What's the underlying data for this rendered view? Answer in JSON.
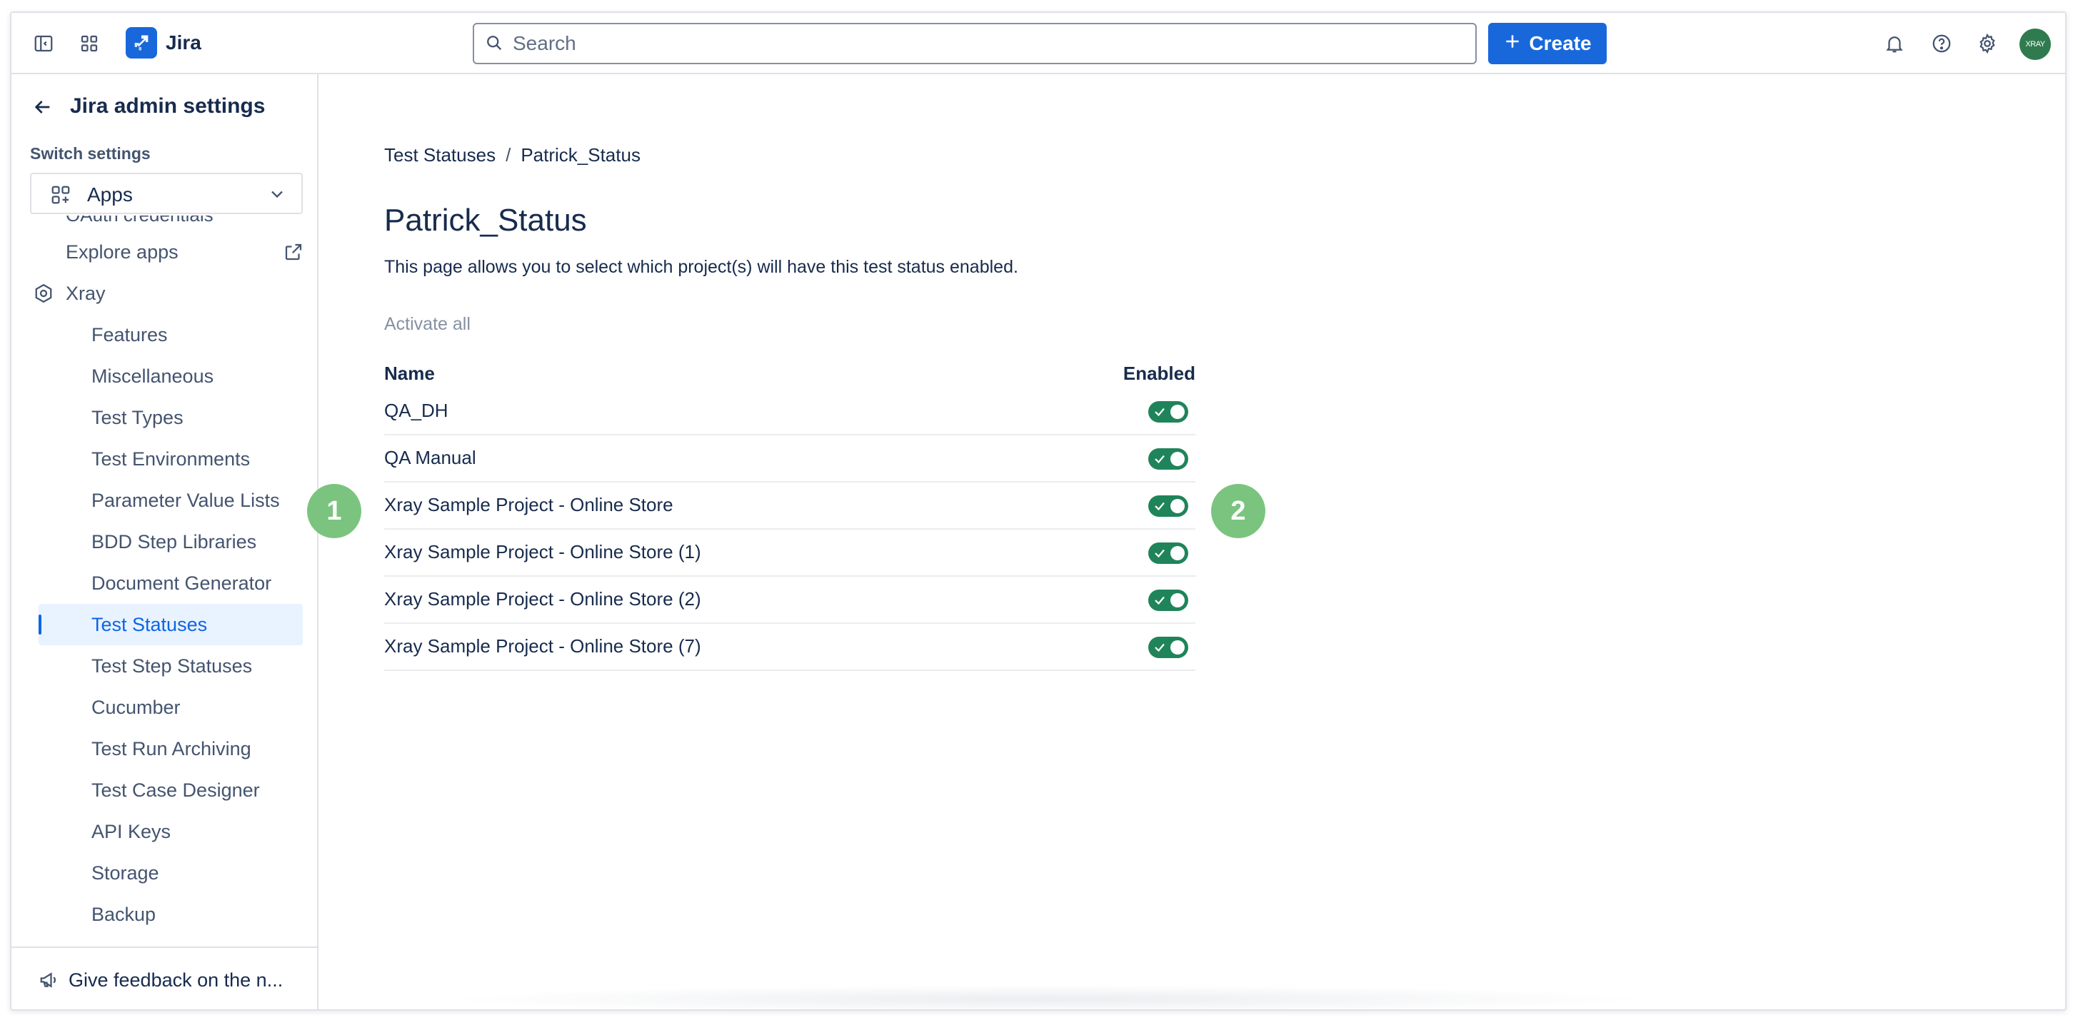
{
  "topbar": {
    "app_name": "Jira",
    "search_placeholder": "Search",
    "create_label": "Create",
    "avatar_initials": "XRAY"
  },
  "sidebar": {
    "title": "Jira admin settings",
    "switch_label": "Switch settings",
    "switch_value": "Apps",
    "cut_item": "OAuth credentials",
    "explore_apps": "Explore apps",
    "section": "Xray",
    "items": [
      "Features",
      "Miscellaneous",
      "Test Types",
      "Test Environments",
      "Parameter Value Lists",
      "BDD Step Libraries",
      "Document Generator",
      "Test Statuses",
      "Test Step Statuses",
      "Cucumber",
      "Test Run Archiving",
      "Test Case Designer",
      "API Keys",
      "Storage",
      "Backup"
    ],
    "selected_item": "Test Statuses",
    "feedback": "Give feedback on the n..."
  },
  "main": {
    "breadcrumbs": [
      "Test Statuses",
      "Patrick_Status"
    ],
    "breadcrumb_sep": "/",
    "title": "Patrick_Status",
    "description": "This page allows you to select which project(s) will have this test status enabled.",
    "activate_all": "Activate all",
    "columns": {
      "name": "Name",
      "enabled": "Enabled"
    },
    "rows": [
      {
        "name": "QA_DH",
        "enabled": true
      },
      {
        "name": "QA Manual",
        "enabled": true
      },
      {
        "name": "Xray Sample Project - Online Store",
        "enabled": true
      },
      {
        "name": "Xray Sample Project - Online Store (1)",
        "enabled": true
      },
      {
        "name": "Xray Sample Project - Online Store (2)",
        "enabled": true
      },
      {
        "name": "Xray Sample Project - Online Store (7)",
        "enabled": true
      }
    ]
  },
  "annotations": [
    "1",
    "2"
  ],
  "colors": {
    "brand": "#1868db",
    "toggle_on": "#1f845a",
    "badge": "#7bc47f",
    "selected_bg": "#e9f2ff",
    "selected_text": "#0c66e4"
  }
}
